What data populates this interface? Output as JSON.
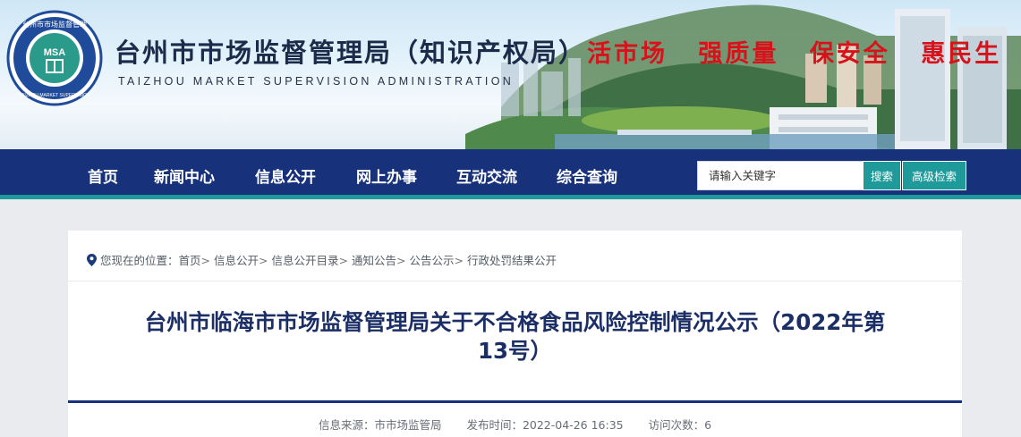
{
  "header": {
    "logo_text": "台州市市场监督管理局 MSA TAIZHOU MARKET SUPERVISION ADMINISTRATION",
    "title": "台州市市场监督管理局（知识产权局）",
    "subtitle": "TAIZHOU MARKET SUPERVISION ADMINISTRATION",
    "slogans": [
      "活市场",
      "强质量",
      "保安全",
      "惠民生"
    ]
  },
  "nav": {
    "items": [
      {
        "label": "首页"
      },
      {
        "label": "新闻中心"
      },
      {
        "label": "信息公开"
      },
      {
        "label": "网上办事"
      },
      {
        "label": "互动交流"
      },
      {
        "label": "综合查询"
      }
    ]
  },
  "search": {
    "placeholder": "请输入关键字",
    "search_label": "搜索",
    "advanced_label": "高级检索"
  },
  "breadcrumb": {
    "prefix": "您现在的位置：",
    "separator": ">",
    "items": [
      "首页",
      "信息公开",
      "信息公开目录",
      "通知公告",
      "公告公示",
      "行政处罚结果公开"
    ]
  },
  "article": {
    "title_line1": "台州市临海市市场监督管理局关于不合格食品风险控制情况公示（2022年第",
    "title_line2": "13号）",
    "source": "信息来源：市市场监管局",
    "publish_time": "发布时间：2022-04-26 16:35",
    "visits": "访问次数：6"
  },
  "colors": {
    "nav_bg": "#17317a",
    "accent_teal": "#1f9a9a",
    "slogan_red": "#d8121b",
    "title_navy": "#1b2f66"
  }
}
